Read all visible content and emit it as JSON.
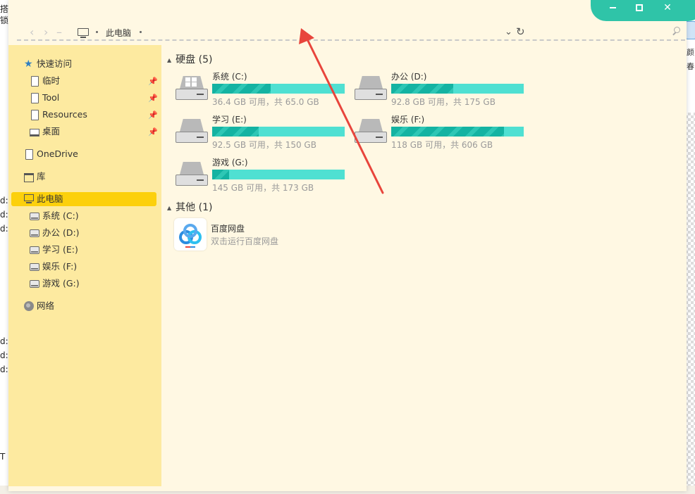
{
  "background": {
    "left_fragments": [
      "搭",
      "锁",
      "d:",
      "d:",
      "d:",
      "d:",
      "d:",
      "d:",
      "T"
    ],
    "right_fragments": [
      "颜",
      "春"
    ]
  },
  "address_bar": {
    "crumb": "此电脑"
  },
  "sidebar": {
    "quick_access": "快速访问",
    "pinned": [
      "临时",
      "Tool",
      "Resources",
      "桌面"
    ],
    "onedrive": "OneDrive",
    "library": "库",
    "this_pc": "此电脑",
    "drives": [
      "系统 (C:)",
      "办公 (D:)",
      "学习 (E:)",
      "娱乐 (F:)",
      "游戏 (G:)"
    ],
    "network": "网络"
  },
  "content": {
    "disks_header": "硬盘 (5)",
    "other_header": "其他 (1)",
    "disks": [
      {
        "name": "系统 (C:)",
        "info": "36.4 GB 可用，共 65.0 GB",
        "used_fraction": 0.44,
        "os": true
      },
      {
        "name": "办公 (D:)",
        "info": "92.8 GB 可用，共 175 GB",
        "used_fraction": 0.47,
        "os": false
      },
      {
        "name": "学习 (E:)",
        "info": "92.5 GB 可用，共 150 GB",
        "used_fraction": 0.35,
        "os": false
      },
      {
        "name": "娱乐 (F:)",
        "info": "118 GB 可用，共 606 GB",
        "used_fraction": 0.85,
        "os": false
      },
      {
        "name": "游戏 (G:)",
        "info": "145 GB 可用，共 173 GB",
        "used_fraction": 0.13,
        "os": false
      }
    ],
    "app": {
      "name": "百度网盘",
      "desc": "双击运行百度网盘"
    }
  },
  "colors": {
    "window_bg": "#fff8e3",
    "sidebar_bg": "#fdeaa0",
    "selected": "#fcd00c",
    "window_controls": "#2fc4a8",
    "bar_bg": "#4fe0d2",
    "bar_fill": "#14b3a2",
    "annotation_arrow": "#e8453c"
  }
}
